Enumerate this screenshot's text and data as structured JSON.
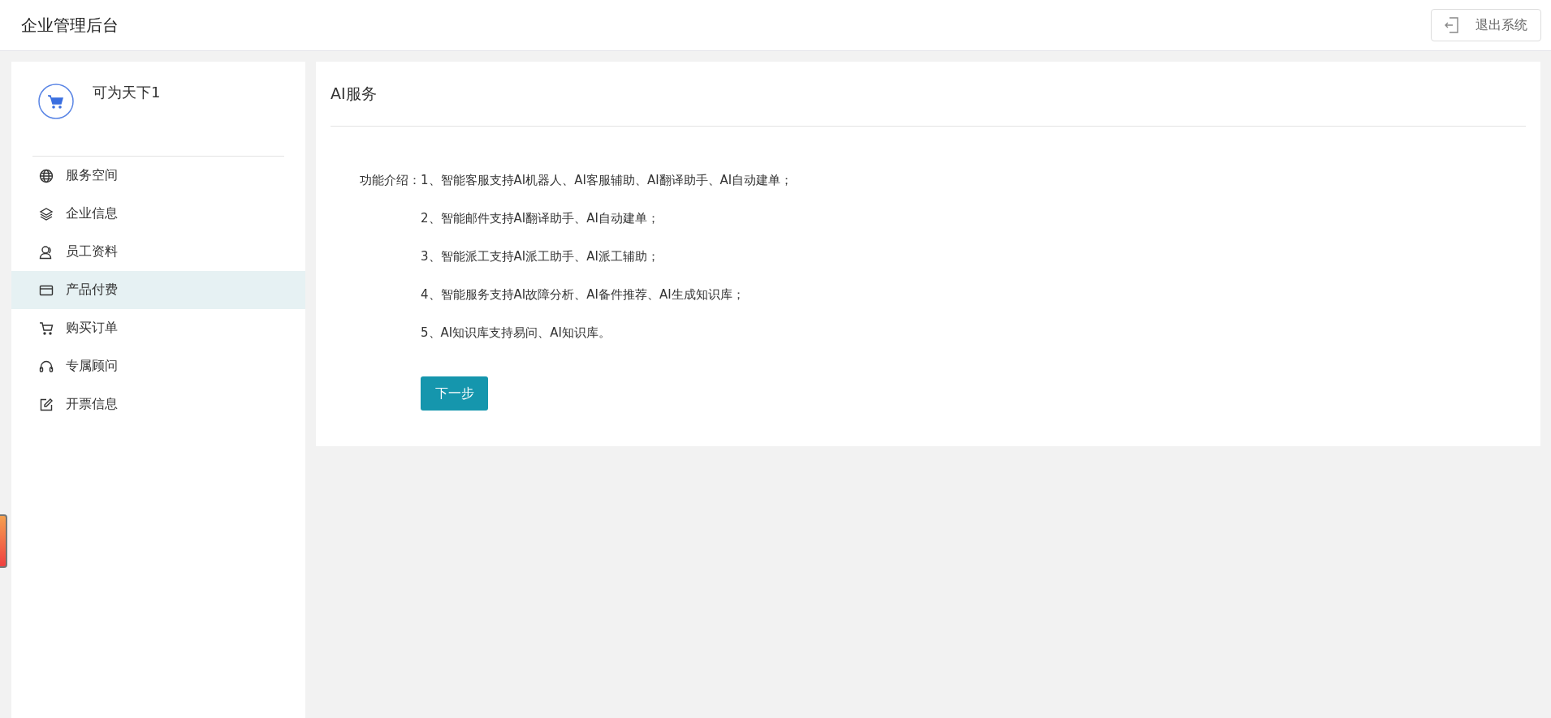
{
  "header": {
    "title": "企业管理后台",
    "logout_button": "退出系统"
  },
  "sidebar": {
    "company_name": "可为天下1",
    "items": [
      {
        "label": "服务空间",
        "selected": false
      },
      {
        "label": "企业信息",
        "selected": false
      },
      {
        "label": "员工资料",
        "selected": false
      },
      {
        "label": "产品付费",
        "selected": true
      },
      {
        "label": "购买订单",
        "selected": false
      },
      {
        "label": "专属顾问",
        "selected": false
      },
      {
        "label": "开票信息",
        "selected": false
      }
    ]
  },
  "panel": {
    "title": "AI服务",
    "intro_label": "功能介绍：",
    "features": [
      "1、智能客服支持AI机器人、AI客服辅助、AI翻译助手、AI自动建单；",
      "2、智能邮件支持AI翻译助手、AI自动建单；",
      "3、智能派工支持AI派工助手、AI派工辅助；",
      "4、智能服务支持AI故障分析、AI备件推荐、AI生成知识库；",
      "5、AI知识库支持易问、AI知识库。"
    ],
    "next_button": "下一步"
  }
}
